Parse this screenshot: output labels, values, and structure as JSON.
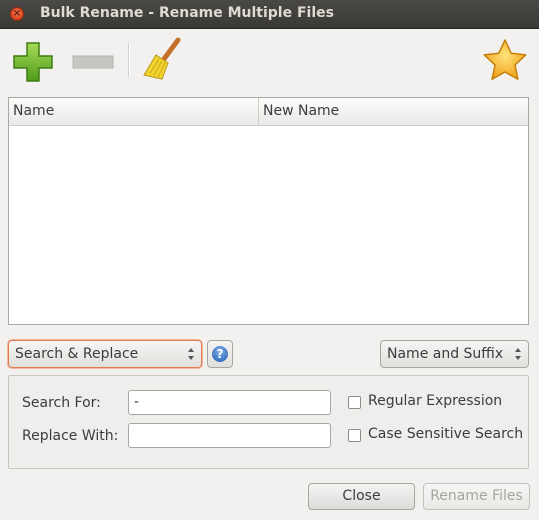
{
  "window": {
    "title": "Bulk Rename - Rename Multiple Files",
    "close_glyph": "×"
  },
  "toolbar": {
    "items": [
      "add-icon",
      "remove-icon",
      "clear-broom-icon",
      "about-star-icon"
    ]
  },
  "table": {
    "columns": [
      "Name",
      "New Name"
    ],
    "rows": []
  },
  "renamer": {
    "selected": "Search & Replace"
  },
  "help": {
    "glyph": "?"
  },
  "name_part": {
    "selected": "Name and Suffix"
  },
  "search_replace": {
    "search_label": "Search For:",
    "search_value": "-",
    "replace_label": "Replace With:",
    "replace_value": "",
    "regex_label": "Regular Expression",
    "regex_checked": false,
    "case_label": "Case Sensitive Search",
    "case_checked": false
  },
  "footer": {
    "close_label": "Close",
    "rename_label": "Rename Files"
  },
  "colors": {
    "title_bar": "#3c3b37",
    "focus_border": "#e27a52",
    "window_bg": "#f2f1f0"
  }
}
